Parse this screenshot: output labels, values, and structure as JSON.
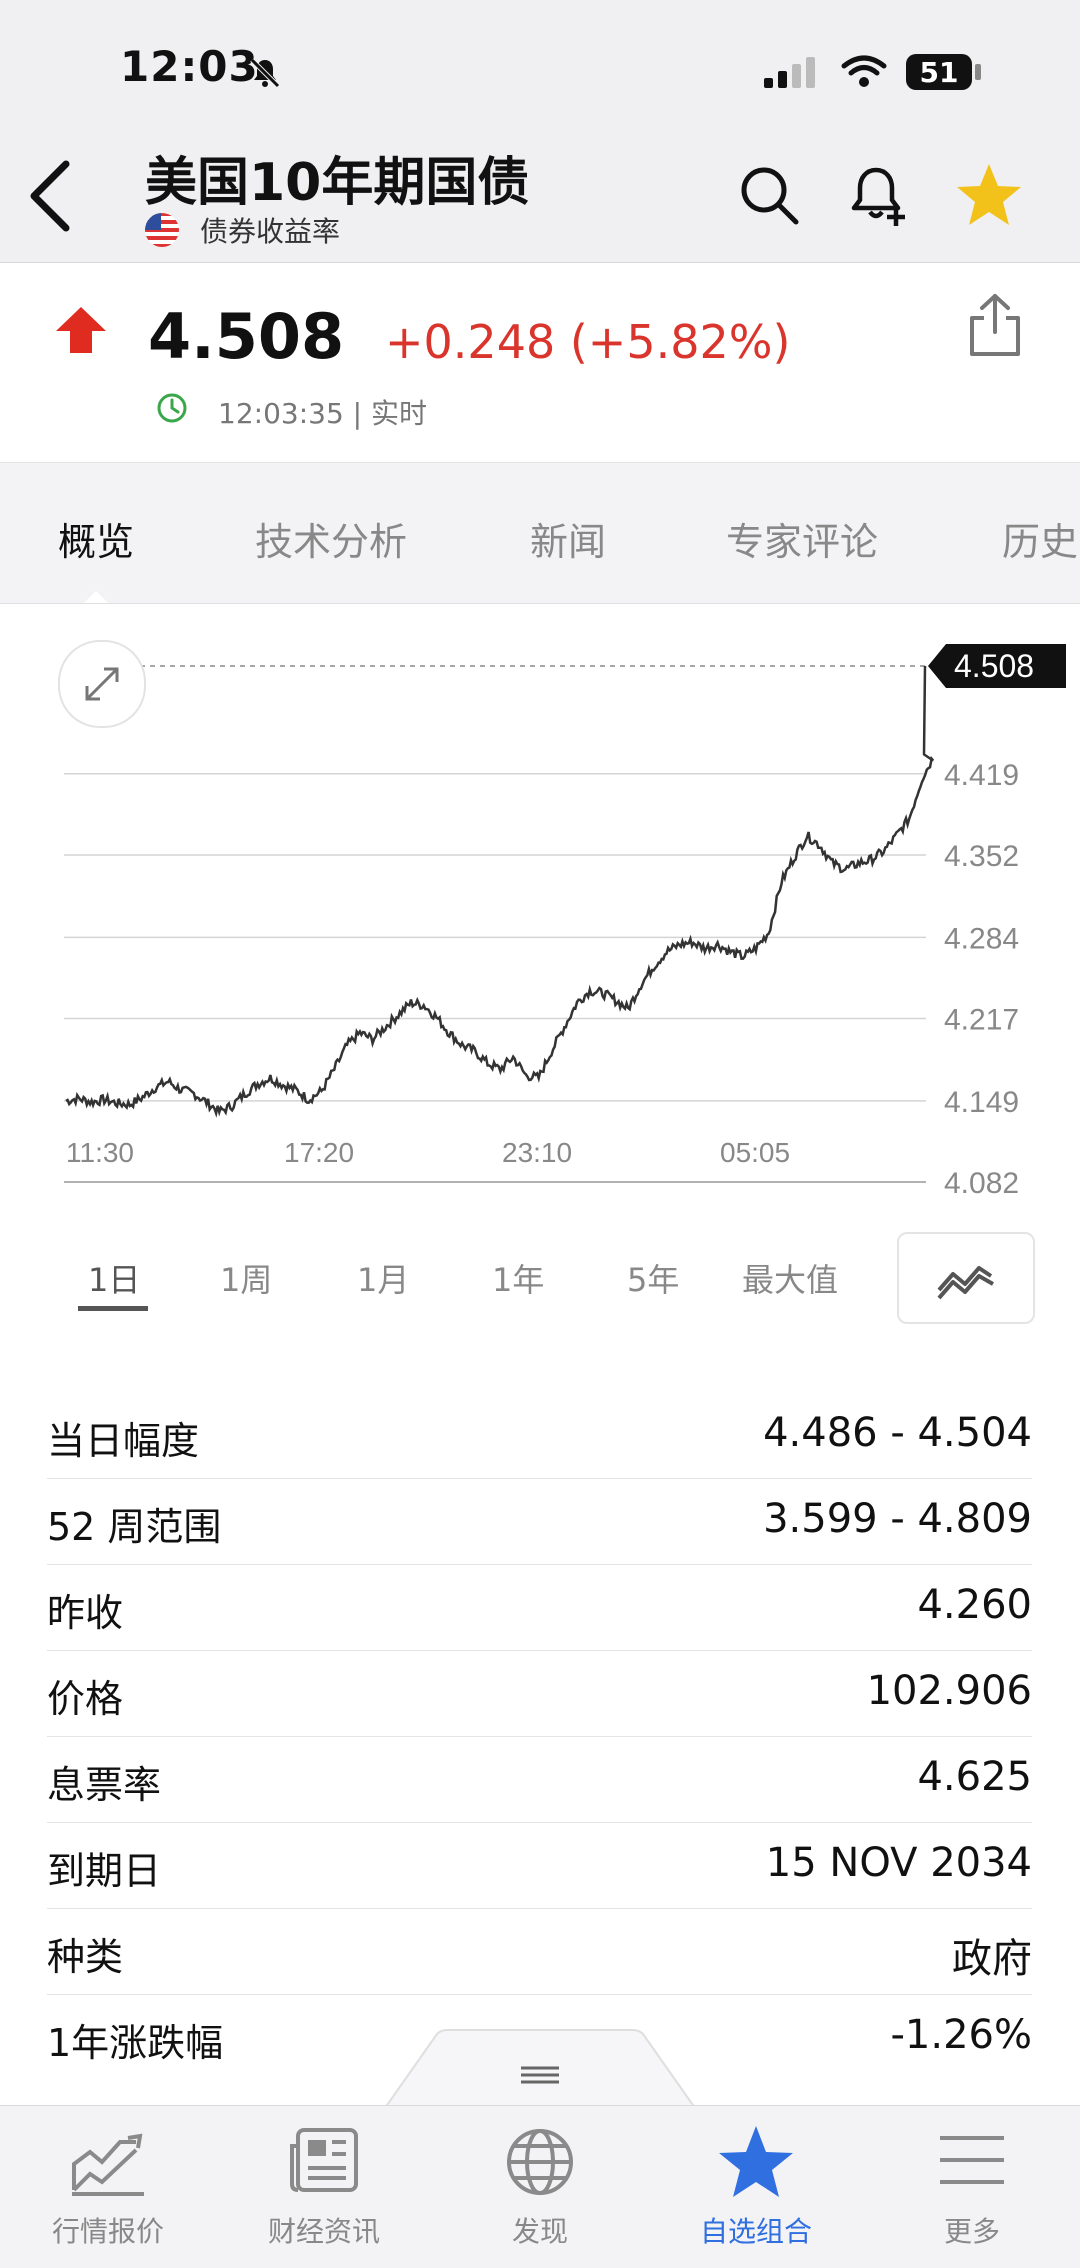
{
  "status_bar": {
    "time": "12:03",
    "battery": "51"
  },
  "header": {
    "title": "美国10年期国债",
    "subtitle": "债券收益率"
  },
  "quote": {
    "price": "4.508",
    "change": "+0.248 (+5.82%)",
    "time": "12:03:35 | 实时",
    "direction": "up",
    "up_color": "#d9352c"
  },
  "tabs": [
    "概览",
    "技术分析",
    "新闻",
    "专家评论",
    "历史"
  ],
  "chart_data": {
    "type": "line",
    "x_ticks": [
      "11:30",
      "17:20",
      "23:10",
      "05:05"
    ],
    "y_ticks": [
      "4.419",
      "4.352",
      "4.284",
      "4.217",
      "4.149",
      "4.082"
    ],
    "ylim": [
      4.082,
      4.508
    ],
    "last_value_label": "4.508",
    "series": [
      {
        "values": [
          4.149,
          4.151,
          4.148,
          4.15,
          4.147,
          4.146,
          4.152,
          4.16,
          4.165,
          4.158,
          4.155,
          4.148,
          4.14,
          4.145,
          4.155,
          4.163,
          4.168,
          4.162,
          4.158,
          4.15,
          4.157,
          4.175,
          4.195,
          4.205,
          4.2,
          4.21,
          4.22,
          4.23,
          4.228,
          4.218,
          4.205,
          4.195,
          4.19,
          4.18,
          4.175,
          4.185,
          4.17,
          4.168,
          4.19,
          4.21,
          4.23,
          4.24,
          4.238,
          4.232,
          4.225,
          4.245,
          4.26,
          4.272,
          4.278,
          4.28,
          4.275,
          4.278,
          4.272,
          4.268,
          4.275,
          4.288,
          4.33,
          4.35,
          4.368,
          4.36,
          4.345,
          4.34,
          4.345,
          4.348,
          4.355,
          4.368,
          4.382,
          4.415,
          4.508
        ]
      }
    ]
  },
  "ranges": [
    "1日",
    "1周",
    "1月",
    "1年",
    "5年",
    "最大值"
  ],
  "stats": [
    {
      "label": "当日幅度",
      "value": "4.486 - 4.504"
    },
    {
      "label": "52 周范围",
      "value": "3.599 - 4.809"
    },
    {
      "label": "昨收",
      "value": "4.260"
    },
    {
      "label": "价格",
      "value": "102.906"
    },
    {
      "label": "息票率",
      "value": "4.625"
    },
    {
      "label": "到期日",
      "value": "15 NOV 2034"
    },
    {
      "label": "种类",
      "value": "政府"
    },
    {
      "label": "1年涨跌幅",
      "value": "-1.26%"
    }
  ],
  "bottom_nav": [
    {
      "label": "行情报价",
      "icon": "chart-icon"
    },
    {
      "label": "财经资讯",
      "icon": "news-icon"
    },
    {
      "label": "发现",
      "icon": "globe-icon"
    },
    {
      "label": "自选组合",
      "icon": "star-icon",
      "active": true
    },
    {
      "label": "更多",
      "icon": "menu-icon"
    }
  ],
  "accent_color": "#2f6fe0",
  "star_color": "#f2c21b"
}
